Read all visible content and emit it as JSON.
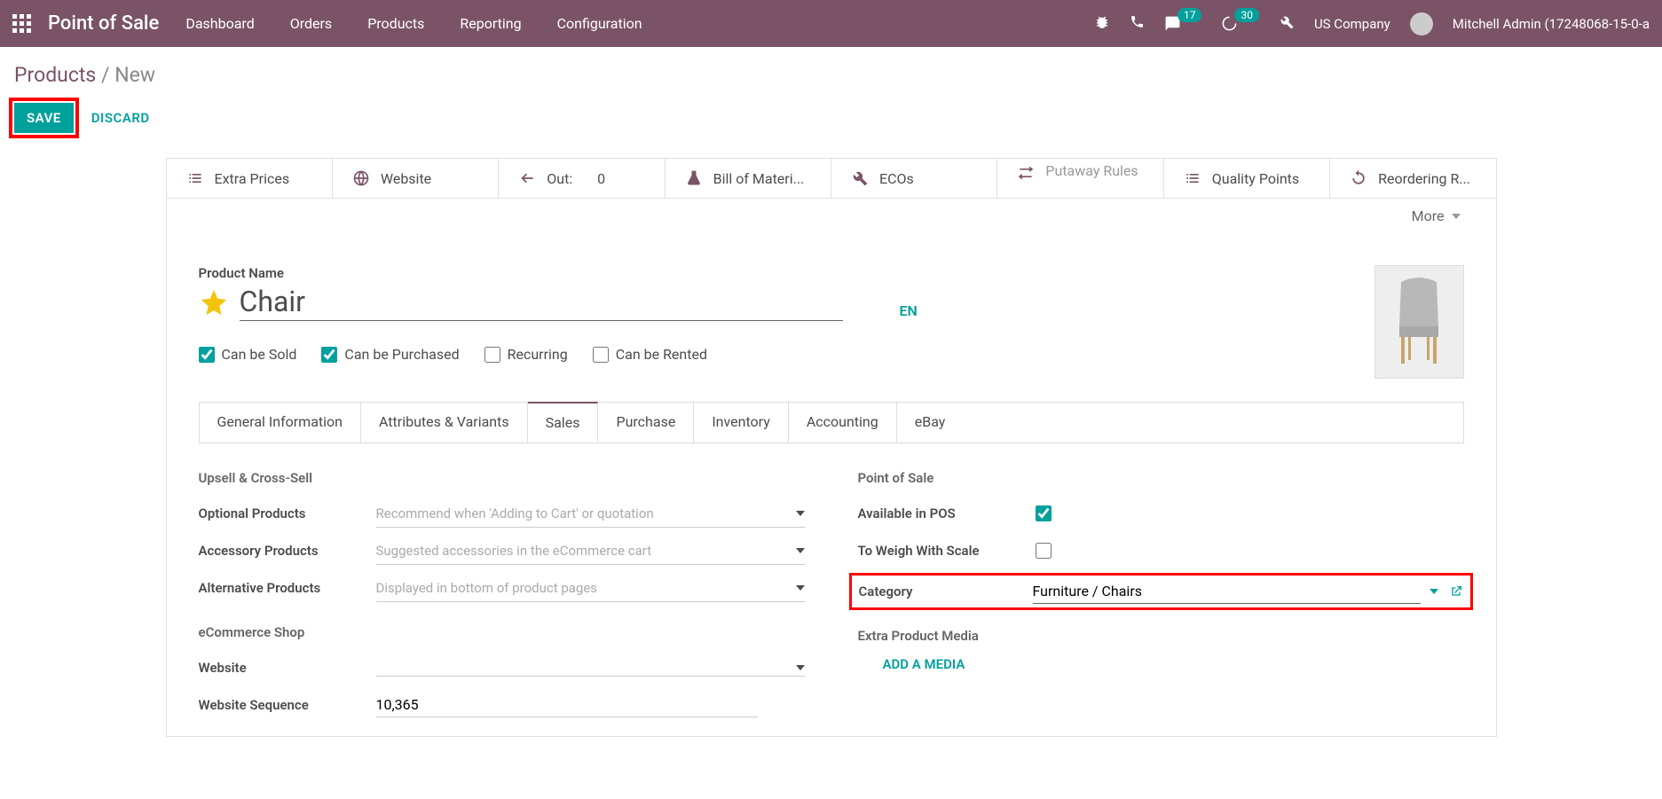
{
  "header": {
    "app_title": "Point of Sale",
    "menu": [
      "Dashboard",
      "Orders",
      "Products",
      "Reporting",
      "Configuration"
    ],
    "company": "US Company",
    "user": "Mitchell Admin (17248068-15-0-a",
    "msg_badge": "17",
    "act_badge": "30"
  },
  "breadcrumb": {
    "root": "Products",
    "current": "New"
  },
  "buttons": {
    "save": "SAVE",
    "discard": "DISCARD"
  },
  "stats": [
    {
      "label": "Extra Prices"
    },
    {
      "label": "Website"
    },
    {
      "label": "Out:",
      "value": "0"
    },
    {
      "label": "Bill of Materi..."
    },
    {
      "label": "ECOs"
    },
    {
      "label": "Putaway Rules"
    },
    {
      "label": "Quality Points"
    },
    {
      "label": "Reordering R..."
    }
  ],
  "more_label": "More",
  "product": {
    "name_label": "Product Name",
    "name": "Chair",
    "lang": "EN",
    "checks": {
      "sold": {
        "label": "Can be Sold",
        "value": true
      },
      "purchased": {
        "label": "Can be Purchased",
        "value": true
      },
      "recurring": {
        "label": "Recurring",
        "value": false
      },
      "rented": {
        "label": "Can be Rented",
        "value": false
      }
    }
  },
  "tabs": [
    "General Information",
    "Attributes & Variants",
    "Sales",
    "Purchase",
    "Inventory",
    "Accounting",
    "eBay"
  ],
  "active_tab": "Sales",
  "sales": {
    "left": {
      "section1": "Upsell & Cross-Sell",
      "optional": {
        "label": "Optional Products",
        "placeholder": "Recommend when 'Adding to Cart' or quotation"
      },
      "accessory": {
        "label": "Accessory Products",
        "placeholder": "Suggested accessories in the eCommerce cart"
      },
      "alternative": {
        "label": "Alternative Products",
        "placeholder": "Displayed in bottom of product pages"
      },
      "section2": "eCommerce Shop",
      "website": {
        "label": "Website"
      },
      "wseq": {
        "label": "Website Sequence",
        "value": "10,365"
      }
    },
    "right": {
      "section1": "Point of Sale",
      "pos": {
        "label": "Available in POS",
        "value": true
      },
      "weigh": {
        "label": "To Weigh With Scale",
        "value": false
      },
      "category": {
        "label": "Category",
        "value": "Furniture / Chairs"
      },
      "section2": "Extra Product Media",
      "add_media": "ADD A MEDIA"
    }
  }
}
